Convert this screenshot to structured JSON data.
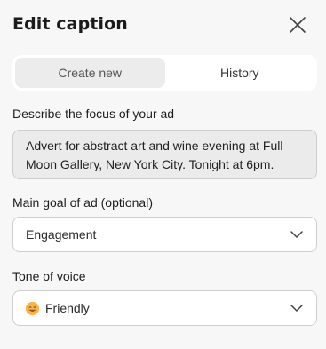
{
  "header": {
    "title": "Edit caption",
    "close_icon": "close-icon"
  },
  "tabs": [
    {
      "label": "Create new",
      "active": true
    },
    {
      "label": "History",
      "active": false
    }
  ],
  "focus": {
    "label": "Describe the focus of your ad",
    "value": "Advert for abstract art and wine evening at Full Moon Gallery, New York City. Tonight at 6pm."
  },
  "goal": {
    "label": "Main goal of ad (optional)",
    "value": "Engagement"
  },
  "tone": {
    "label": "Tone of voice",
    "value": "Friendly",
    "icon": "smiling-face-icon"
  },
  "colors": {
    "background": "#f7f7f7",
    "input_bg": "#ebebeb",
    "emoji": "#f6b544"
  }
}
